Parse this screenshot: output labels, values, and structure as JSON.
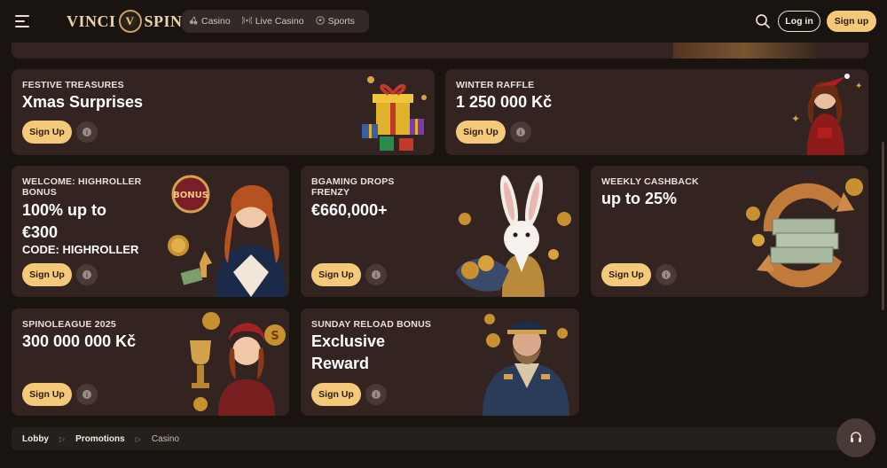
{
  "brand": {
    "logo_left": "VINCI",
    "logo_right": "SPIN",
    "logo_mark": "V"
  },
  "nav": [
    {
      "label": "Casino",
      "icon": "cherries-icon"
    },
    {
      "label": "Live Casino",
      "icon": "broadcast-icon"
    },
    {
      "label": "Sports",
      "icon": "soccer-ball-icon"
    }
  ],
  "header": {
    "login_label": "Log in",
    "signup_label": "Sign up"
  },
  "colors": {
    "background": "#1a1411",
    "card": "#332421",
    "accent": "#f5c97a",
    "info_button": "#4a3a35"
  },
  "promos": [
    {
      "kicker": "FESTIVE TREASURES",
      "headline": "Xmas Surprises",
      "cta": "Sign Up",
      "info_icon": "i"
    },
    {
      "kicker": "WINTER RAFFLE",
      "headline": "1 250 000 Kč",
      "cta": "Sign Up",
      "info_icon": "i"
    },
    {
      "kicker": "WELCOME: HIGHROLLER BONUS",
      "headline": "100% up to €300",
      "subline": "CODE: HIGHROLLER",
      "cta": "Sign Up",
      "info_icon": "i",
      "art_badge": "BONUS"
    },
    {
      "kicker": "BGAMING DROPS FRENZY",
      "headline": "€660,000+",
      "cta": "Sign Up",
      "info_icon": "i"
    },
    {
      "kicker": "WEEKLY CASHBACK",
      "headline": "up to 25%",
      "cta": "Sign Up",
      "info_icon": "i"
    },
    {
      "kicker": "SPINOLEAGUE 2025",
      "headline": "300 000 000 Kč",
      "cta": "Sign Up",
      "info_icon": "i"
    },
    {
      "kicker": "SUNDAY RELOAD BONUS",
      "headline": "Exclusive Reward",
      "cta": "Sign Up",
      "info_icon": "i"
    }
  ],
  "breadcrumb": [
    {
      "label": "Lobby"
    },
    {
      "label": "Promotions"
    },
    {
      "label": "Casino"
    }
  ],
  "breadcrumb_separator": "▷",
  "support_icon": "headset-icon"
}
